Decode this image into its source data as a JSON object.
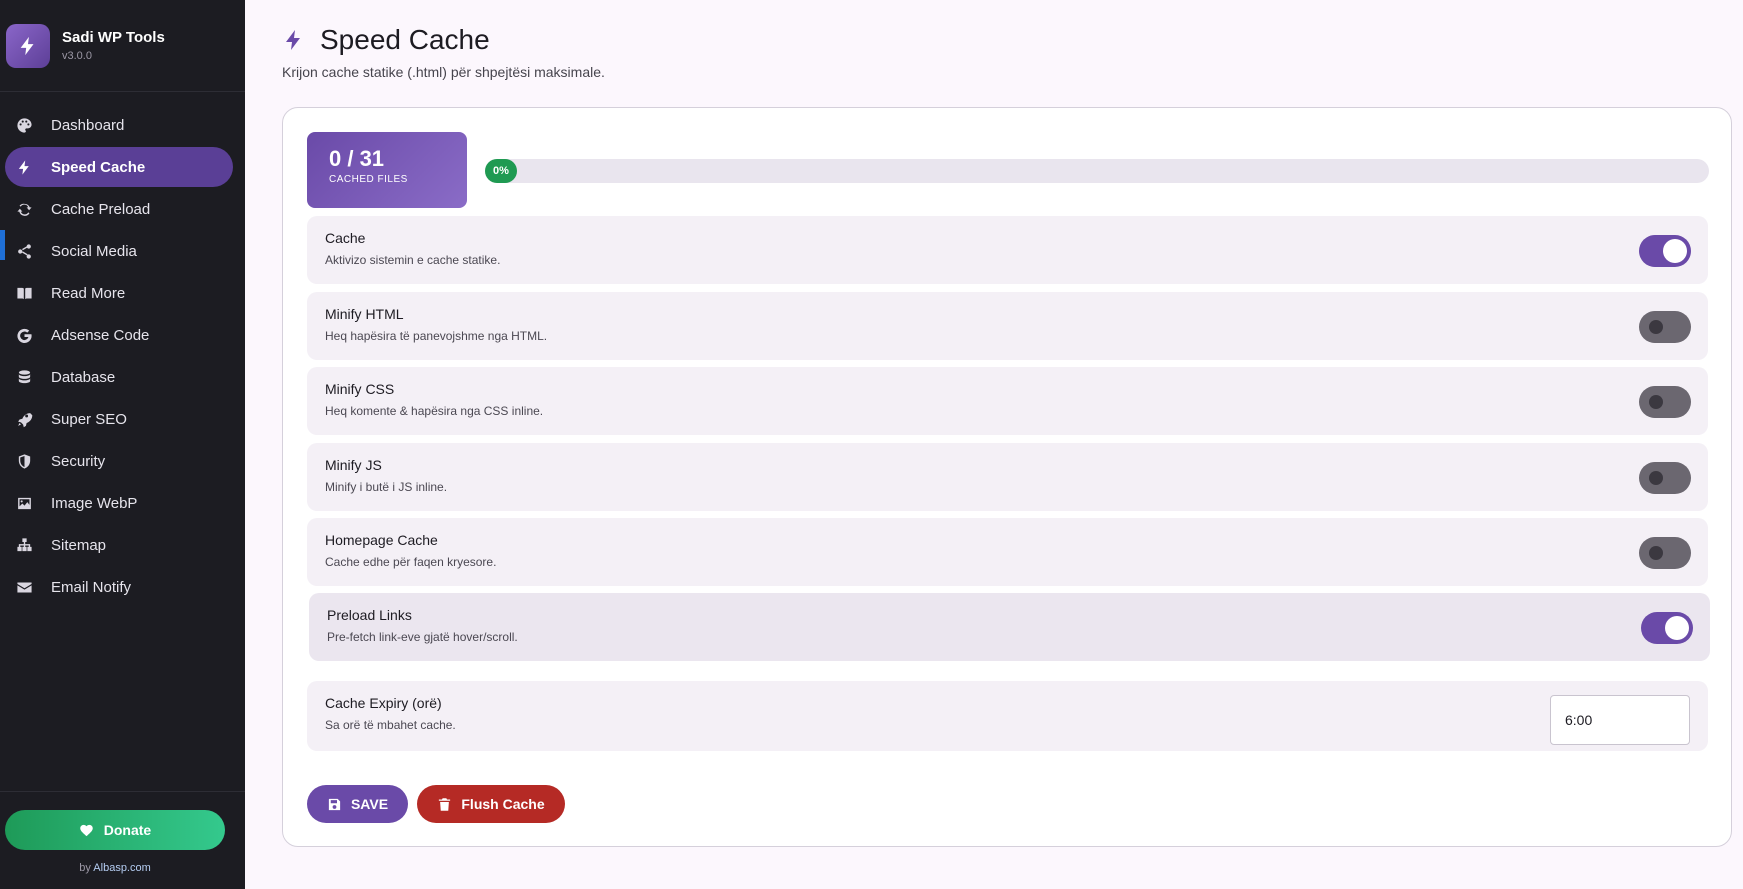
{
  "brand": {
    "title": "Sadi WP Tools",
    "version": "v3.0.0"
  },
  "sidebar": {
    "items": [
      {
        "label": "Dashboard",
        "icon": "palette-icon"
      },
      {
        "label": "Speed Cache",
        "icon": "bolt-icon",
        "active": true
      },
      {
        "label": "Cache Preload",
        "icon": "sync-icon"
      },
      {
        "label": "Social Media",
        "icon": "share-icon"
      },
      {
        "label": "Read More",
        "icon": "book-icon"
      },
      {
        "label": "Adsense Code",
        "icon": "google-icon"
      },
      {
        "label": "Database",
        "icon": "database-icon"
      },
      {
        "label": "Super SEO",
        "icon": "rocket-icon"
      },
      {
        "label": "Security",
        "icon": "shield-icon"
      },
      {
        "label": "Image WebP",
        "icon": "image-icon"
      },
      {
        "label": "Sitemap",
        "icon": "sitemap-icon"
      },
      {
        "label": "Email Notify",
        "icon": "envelope-icon"
      }
    ],
    "donate_label": "Donate",
    "by_prefix": "by ",
    "by_link": "Albasp.com"
  },
  "page": {
    "title": "Speed Cache",
    "subtitle": "Krijon cache statike (.html) për shpejtësi maksimale."
  },
  "stats": {
    "value": "0 / 31",
    "label": "CACHED FILES"
  },
  "progress": {
    "percent": 0,
    "label": "0%"
  },
  "settings": [
    {
      "name": "Cache",
      "desc": "Aktivizo sistemin e cache statike.",
      "enabled": true
    },
    {
      "name": "Minify HTML",
      "desc": "Heq hapësira të panevojshme nga HTML.",
      "enabled": false
    },
    {
      "name": "Minify CSS",
      "desc": "Heq komente & hapësira nga CSS inline.",
      "enabled": false
    },
    {
      "name": "Minify JS",
      "desc": "Minify i butë i JS inline.",
      "enabled": false
    },
    {
      "name": "Homepage Cache",
      "desc": "Cache edhe për faqen kryesore.",
      "enabled": false
    },
    {
      "name": "Preload Links",
      "desc": "Pre-fetch link-eve gjatë hover/scroll.",
      "enabled": true
    }
  ],
  "expiry": {
    "name": "Cache Expiry (orë)",
    "desc": "Sa orë të mbahet cache.",
    "value": "6:00"
  },
  "buttons": {
    "save": "SAVE",
    "flush": "Flush Cache"
  },
  "colors": {
    "accent": "#6a4aa8",
    "sidebar_bg": "#1c1c22",
    "danger": "#b52a25",
    "success": "#1f9a52"
  }
}
